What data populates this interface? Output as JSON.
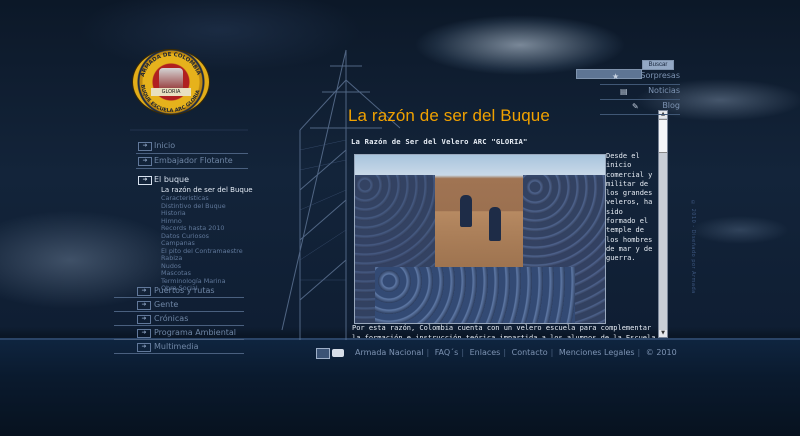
{
  "logo": {
    "top_text": "ARMADA DE COLOMBIA",
    "bottom_text": "BUQUE ESCUELA ARC GLORIA",
    "ribbon": "GLORIA"
  },
  "menu": {
    "main_items": [
      {
        "label": "Inicio"
      },
      {
        "label": "Embajador Flotante"
      },
      {
        "label": "El buque"
      }
    ],
    "submenu": [
      "La razón de ser del Buque",
      "Caracteristicas",
      "Distintivo del Buque",
      "Historia",
      "Himno",
      "Records hasta 2010",
      "Datos Curiosos",
      "Campanas",
      "El pito del Contramaestre",
      "Rabiza",
      "Nudos",
      "Mascotas",
      "Terminología Marina",
      "Obra Social"
    ],
    "lower_items": [
      {
        "label": "Puertos y rutas"
      },
      {
        "label": "Gente"
      },
      {
        "label": "Crónicas"
      },
      {
        "label": "Programa Ambiental"
      },
      {
        "label": "Multimedia"
      }
    ]
  },
  "content": {
    "title": "La razón de ser del Buque",
    "subtitle": "La Razón de Ser del Velero ARC \"GLORIA\"",
    "side_text": "Desde el inicio comercial y militar de los grandes veleros, ha sido formado el temple de los hombres de mar y de guerra.",
    "bottom_text": "Por esta razón, Colombia cuenta con un velero escuela para complementar la formación e instrucción teórica impartida a los alumnos de la Escuela Naval de"
  },
  "search": {
    "placeholder": "",
    "button_label": "Buscar"
  },
  "top_links": [
    {
      "label": "Sorpresas",
      "icon": "star-icon"
    },
    {
      "label": "Noticias",
      "icon": "document-icon"
    },
    {
      "label": "Blog",
      "icon": "edit-icon"
    }
  ],
  "footer": {
    "links": [
      "Armada Nacional",
      "FAQ´s",
      "Enlaces",
      "Contacto",
      "Menciones Legales"
    ],
    "copyright": "© 2010"
  },
  "credit": "© 2010 - Diseñado por Armada"
}
